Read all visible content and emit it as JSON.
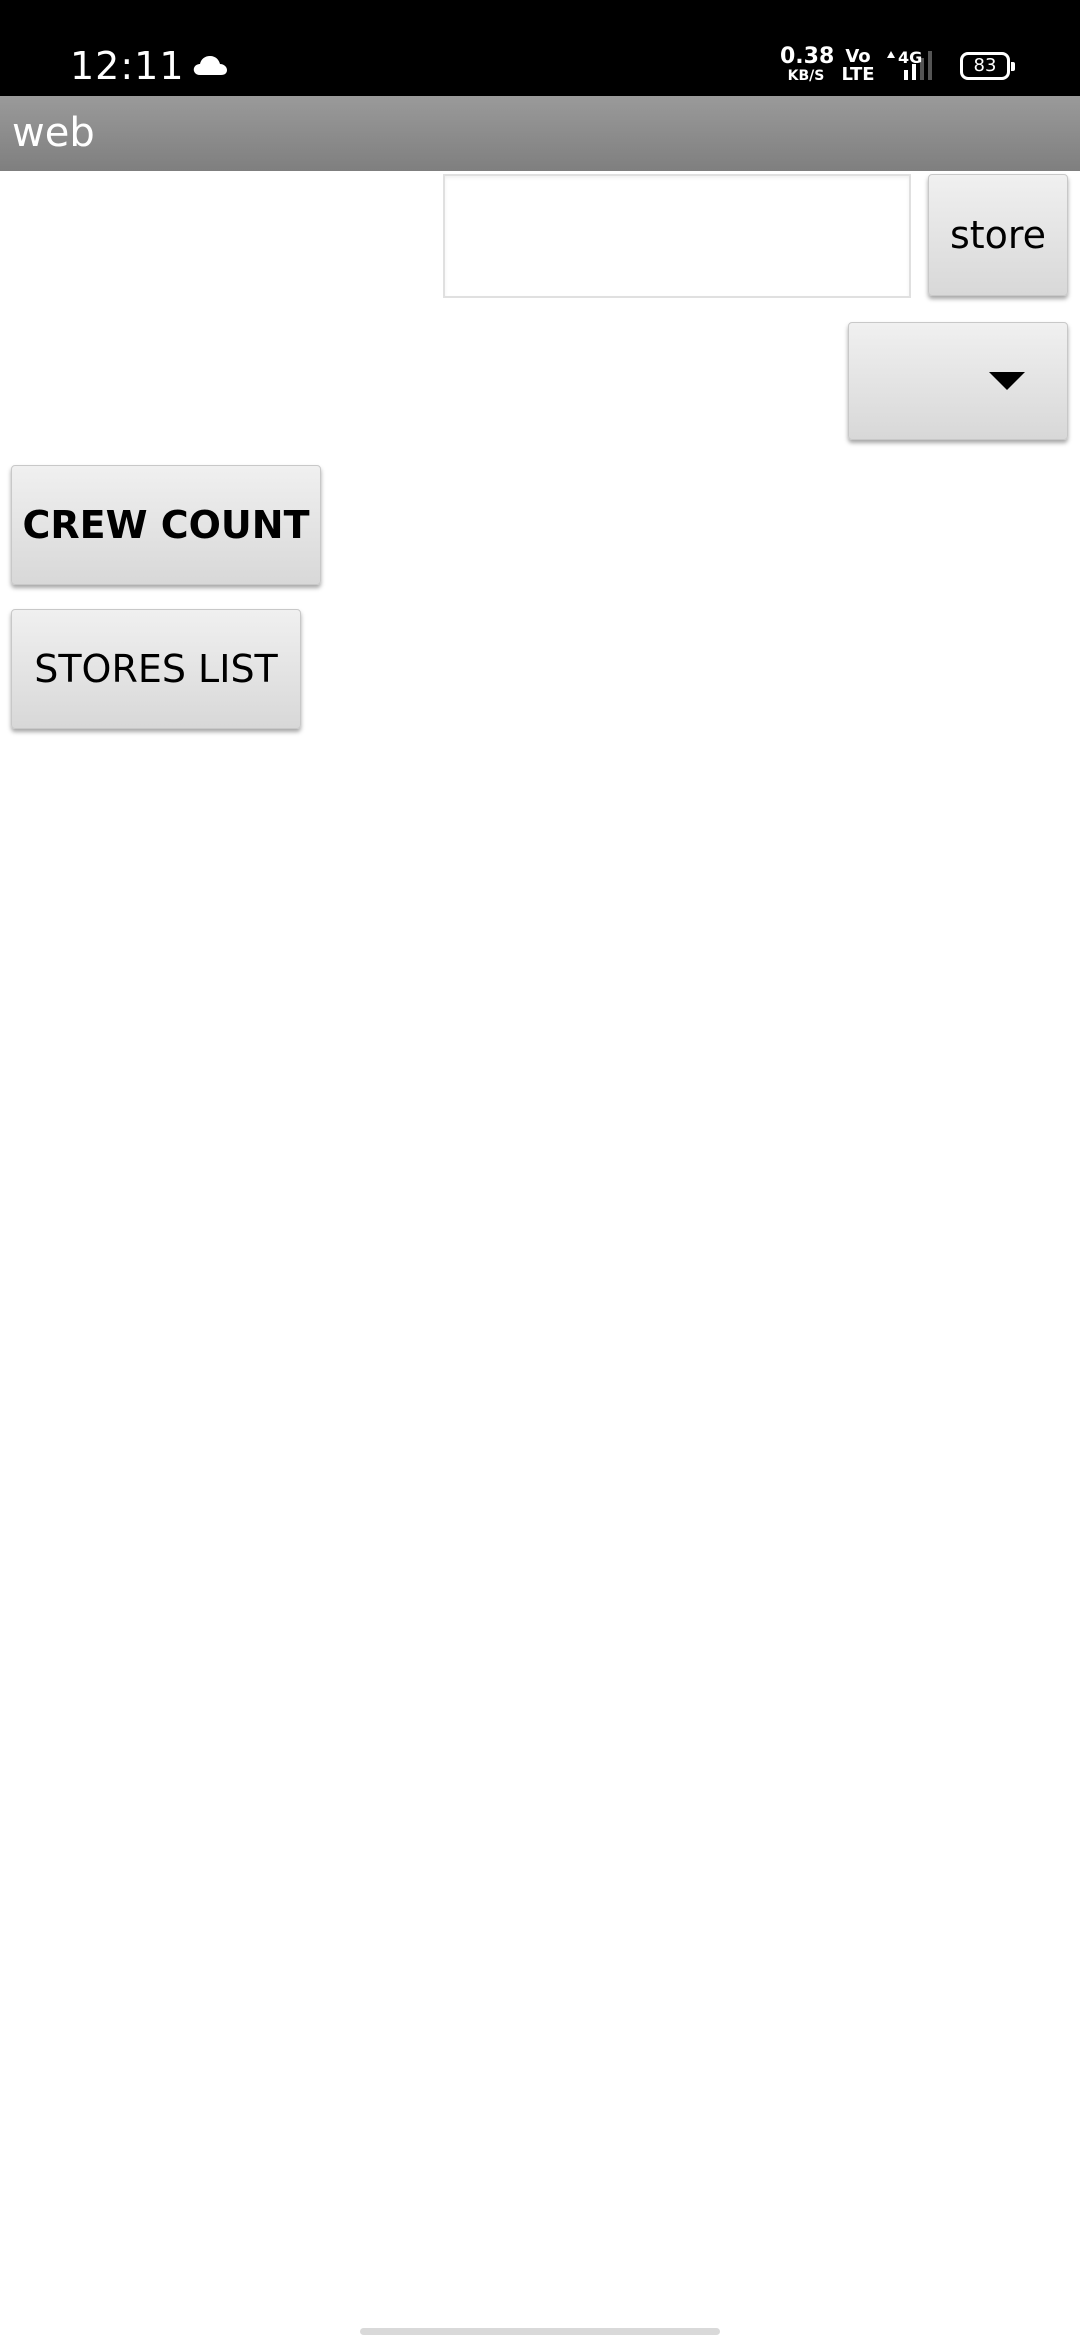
{
  "status_bar": {
    "time": "12:11",
    "net_speed_value": "0.38",
    "net_speed_unit": "KB/S",
    "volte_top": "Vo",
    "volte_bottom": "LTE",
    "network_type": "4G",
    "battery_level": "83",
    "weather_icon": "cloud-icon",
    "signal_icon": "signal-icon"
  },
  "title_bar": {
    "title": "web"
  },
  "form": {
    "store_input_value": "",
    "store_button_label": "store",
    "dropdown_selected": "",
    "dropdown_icon": "caret-down-icon"
  },
  "actions": {
    "crew_count_label": "CREW COUNT",
    "stores_list_label": "STORES LIST"
  },
  "colors": {
    "status_bar_bg": "#000000",
    "title_bar_bg": "#8c8c8c",
    "button_bg": "#e4e4e4",
    "page_bg": "#ffffff"
  }
}
